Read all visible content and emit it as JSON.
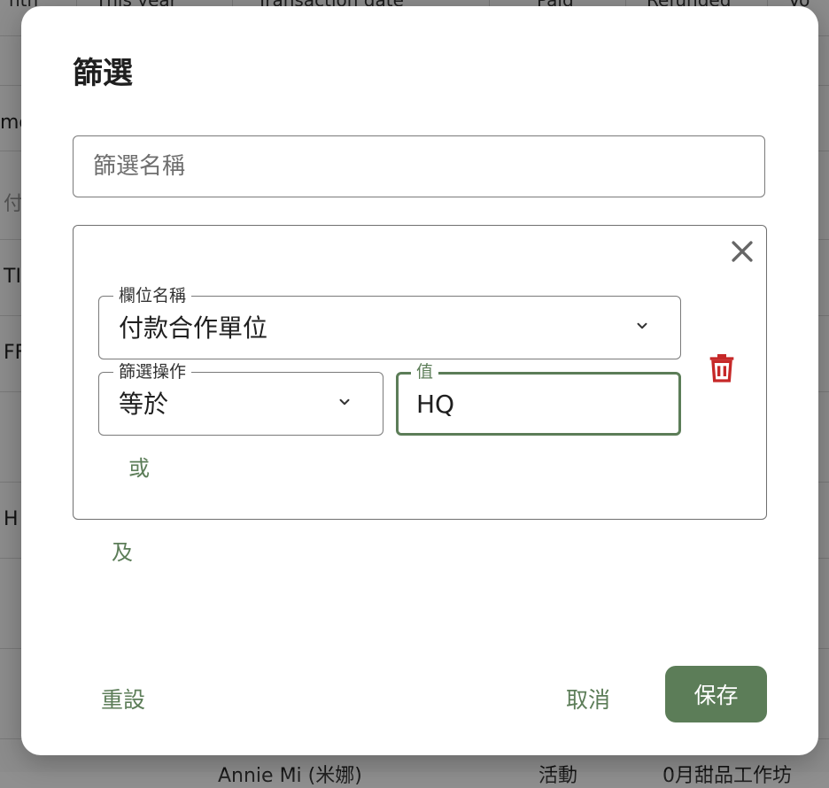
{
  "background": {
    "headers": [
      "nth",
      "This year",
      "Transaction date",
      "Paid",
      "Refunded",
      "Vo"
    ],
    "row_fragments": [
      "mo",
      "付",
      "TI",
      "FF",
      "H",
      "Annie Mi (米娜)",
      "活動",
      "0月甜品工作坊"
    ]
  },
  "dialog": {
    "title": "篩選",
    "filter_name_placeholder": "篩選名稱",
    "condition": {
      "field_label": "欄位名稱",
      "field_value": "付款合作單位",
      "operator_label": "篩選操作",
      "operator_value": "等於",
      "value_label": "值",
      "value_value": "HQ"
    },
    "or_label": "或",
    "and_label": "及",
    "reset_label": "重設",
    "cancel_label": "取消",
    "save_label": "保存"
  },
  "colors": {
    "accent": "#5c7d58",
    "danger": "#c62828"
  },
  "icons": {
    "close": "close-icon",
    "dropdown": "chevron-down-icon",
    "delete": "trash-icon"
  }
}
